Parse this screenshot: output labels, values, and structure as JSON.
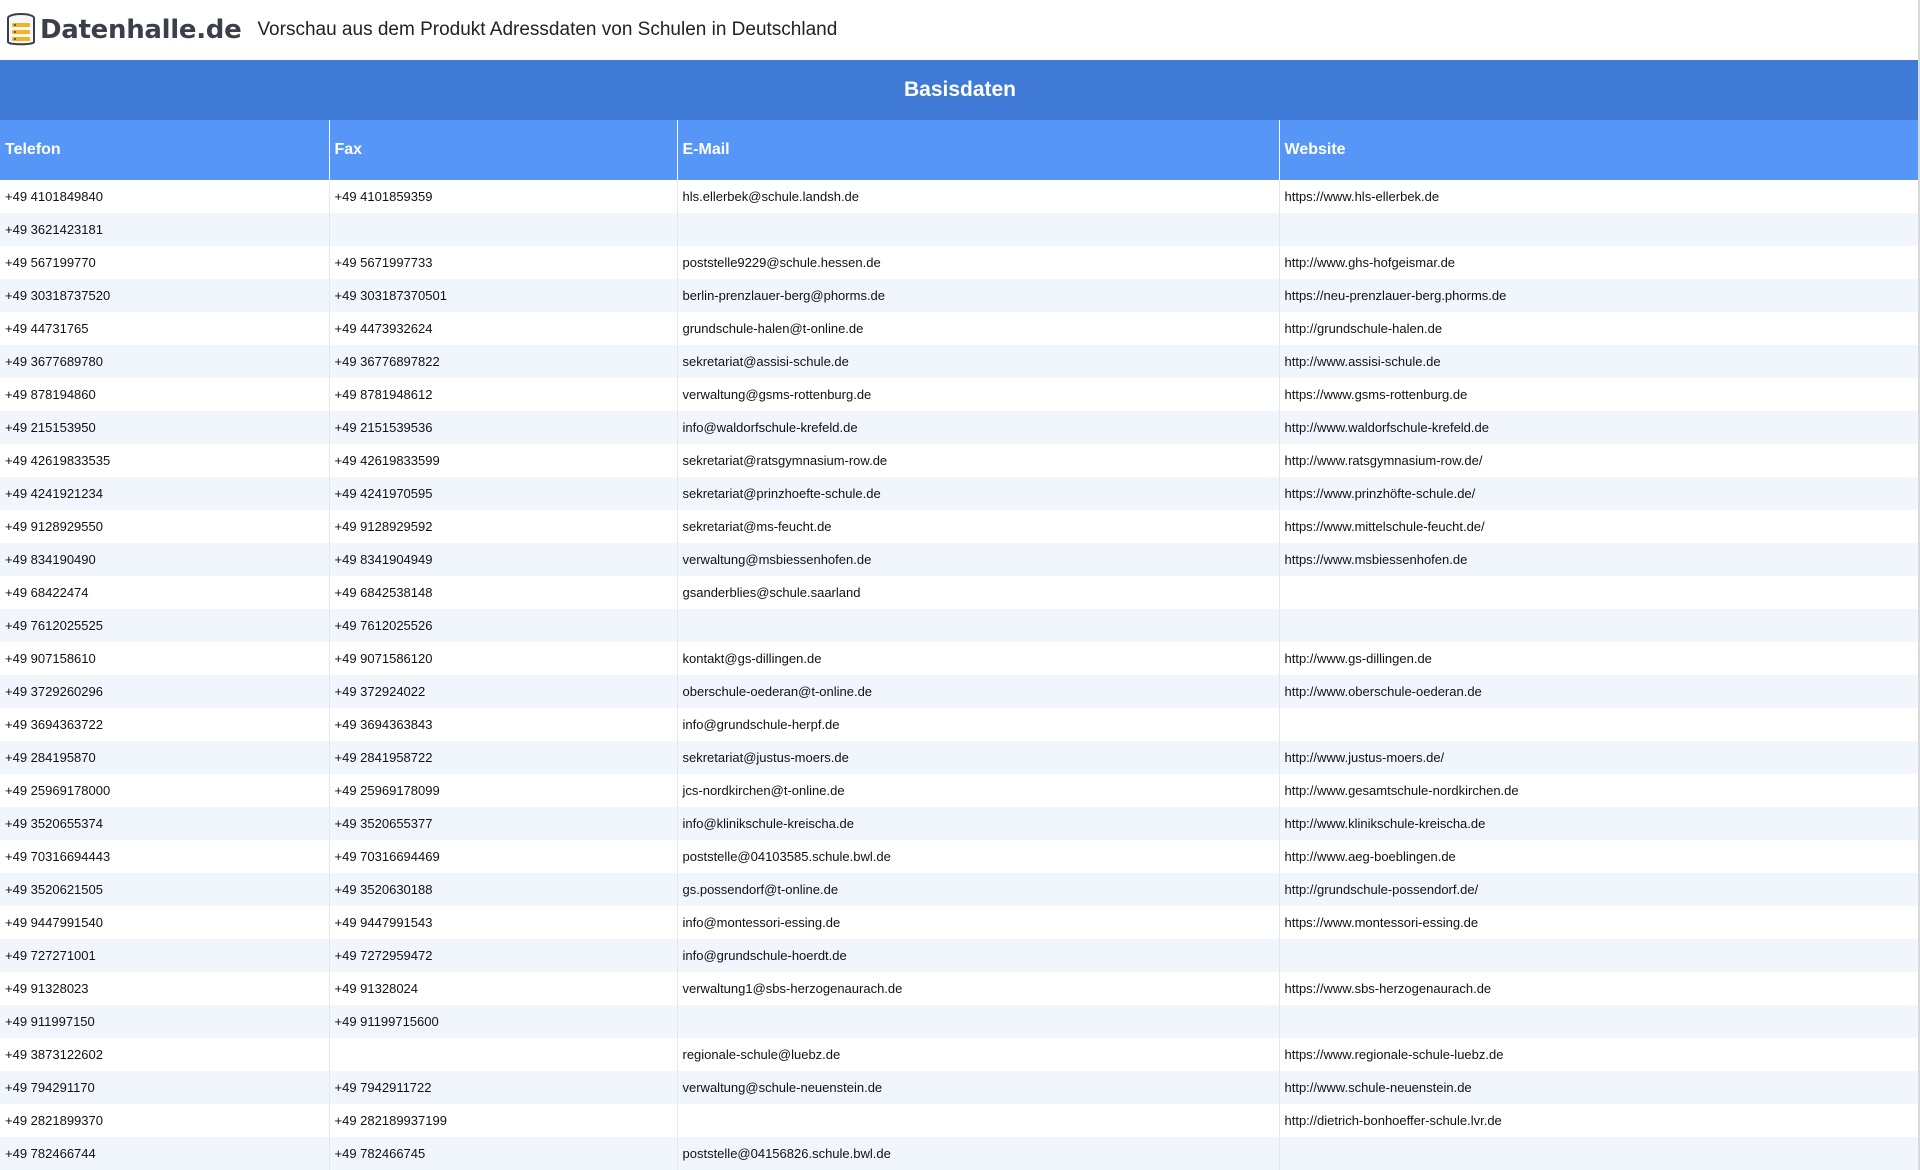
{
  "header": {
    "logo_text": "Datenhalle.de",
    "logo_icon": "server-stack-icon",
    "title": "Vorschau aus dem Produkt Adressdaten von Schulen in Deutschland"
  },
  "section": {
    "title": "Basisdaten"
  },
  "table": {
    "columns": [
      "Telefon",
      "Fax",
      "E-Mail",
      "Website"
    ],
    "rows": [
      [
        "+49 4101849840",
        "+49 4101859359",
        "hls.ellerbek@schule.landsh.de",
        "https://www.hls-ellerbek.de"
      ],
      [
        "+49 3621423181",
        "",
        "",
        ""
      ],
      [
        "+49 567199770",
        "+49 5671997733",
        "poststelle9229@schule.hessen.de",
        "http://www.ghs-hofgeismar.de"
      ],
      [
        "+49 30318737520",
        "+49 303187370501",
        "berlin-prenzlauer-berg@phorms.de",
        "https://neu-prenzlauer-berg.phorms.de"
      ],
      [
        "+49 44731765",
        "+49 4473932624",
        "grundschule-halen@t-online.de",
        "http://grundschule-halen.de"
      ],
      [
        "+49 3677689780",
        "+49 36776897822",
        "sekretariat@assisi-schule.de",
        "http://www.assisi-schule.de"
      ],
      [
        "+49 878194860",
        "+49 8781948612",
        "verwaltung@gsms-rottenburg.de",
        "https://www.gsms-rottenburg.de"
      ],
      [
        "+49 215153950",
        "+49 2151539536",
        "info@waldorfschule-krefeld.de",
        "http://www.waldorfschule-krefeld.de"
      ],
      [
        "+49 42619833535",
        "+49 42619833599",
        "sekretariat@ratsgymnasium-row.de",
        "http://www.ratsgymnasium-row.de/"
      ],
      [
        "+49 4241921234",
        "+49 4241970595",
        "sekretariat@prinzhoefte-schule.de",
        "https://www.prinzhöfte-schule.de/"
      ],
      [
        "+49 9128929550",
        "+49 9128929592",
        "sekretariat@ms-feucht.de",
        "https://www.mittelschule-feucht.de/"
      ],
      [
        "+49 834190490",
        "+49 8341904949",
        "verwaltung@msbiessenhofen.de",
        "https://www.msbiessenhofen.de"
      ],
      [
        "+49 68422474",
        "+49 6842538148",
        "gsanderblies@schule.saarland",
        ""
      ],
      [
        "+49 7612025525",
        "+49 7612025526",
        "",
        ""
      ],
      [
        "+49 907158610",
        "+49 9071586120",
        "kontakt@gs-dillingen.de",
        "http://www.gs-dillingen.de"
      ],
      [
        "+49 3729260296",
        "+49 372924022",
        "oberschule-oederan@t-online.de",
        "http://www.oberschule-oederan.de"
      ],
      [
        "+49 3694363722",
        "+49 3694363843",
        "info@grundschule-herpf.de",
        ""
      ],
      [
        "+49 284195870",
        "+49 2841958722",
        "sekretariat@justus-moers.de",
        "http://www.justus-moers.de/"
      ],
      [
        "+49 25969178000",
        "+49 25969178099",
        "jcs-nordkirchen@t-online.de",
        "http://www.gesamtschule-nordkirchen.de"
      ],
      [
        "+49 3520655374",
        "+49 3520655377",
        "info@klinikschule-kreischa.de",
        "http://www.klinikschule-kreischa.de"
      ],
      [
        "+49 70316694443",
        "+49 70316694469",
        "poststelle@04103585.schule.bwl.de",
        "http://www.aeg-boeblingen.de"
      ],
      [
        "+49 3520621505",
        "+49 3520630188",
        "gs.possendorf@t-online.de",
        "http://grundschule-possendorf.de/"
      ],
      [
        "+49 9447991540",
        "+49 9447991543",
        "info@montessori-essing.de",
        "https://www.montessori-essing.de"
      ],
      [
        "+49 727271001",
        "+49 7272959472",
        "info@grundschule-hoerdt.de",
        ""
      ],
      [
        "+49 91328023",
        "+49 91328024",
        "verwaltung1@sbs-herzogenaurach.de",
        "https://www.sbs-herzogenaurach.de"
      ],
      [
        "+49 911997150",
        "+49 91199715600",
        "",
        ""
      ],
      [
        "+49 3873122602",
        "",
        "regionale-schule@luebz.de",
        "https://www.regionale-schule-luebz.de"
      ],
      [
        "+49 794291170",
        "+49 7942911722",
        "verwaltung@schule-neuenstein.de",
        "http://www.schule-neuenstein.de"
      ],
      [
        "+49 2821899370",
        "+49 282189937199",
        "",
        "http://dietrich-bonhoeffer-schule.lvr.de"
      ],
      [
        "+49 782466744",
        "+49 782466745",
        "poststelle@04156826.schule.bwl.de",
        ""
      ]
    ]
  },
  "colors": {
    "section_header_bg": "#3f7ad6",
    "column_header_bg": "#5596f7",
    "row_alt_bg": "#f1f5fc"
  }
}
